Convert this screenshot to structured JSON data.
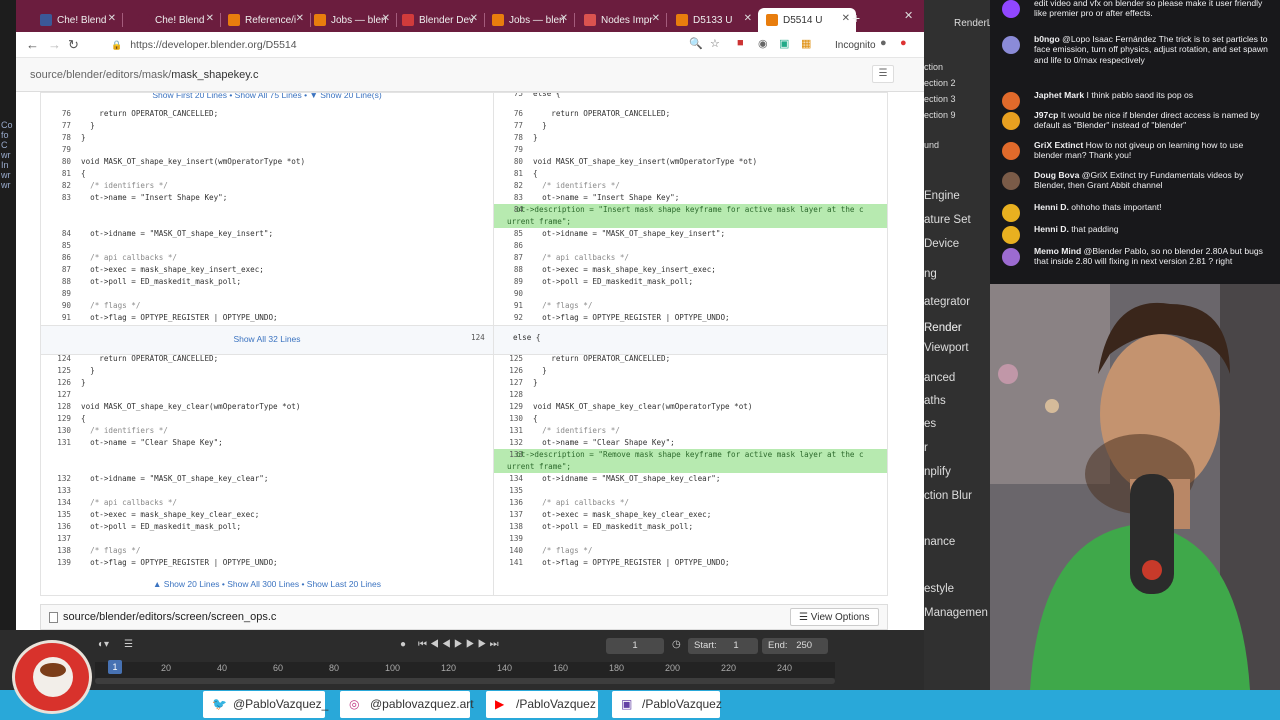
{
  "left_strip": {
    "lines": [
      "Co",
      "fo",
      "C",
      "",
      "",
      "",
      "",
      "",
      "",
      "",
      "",
      "",
      "",
      "wr",
      "In",
      "wr",
      "wr"
    ]
  },
  "browser": {
    "tabs": [
      {
        "label": "Che! Blend",
        "color": "#3b5998"
      },
      {
        "label": "Che! Blend",
        "color": "#6b1d3e"
      },
      {
        "label": "Reference/i",
        "color": "#e87d0d"
      },
      {
        "label": "Jobs — blen",
        "color": "#e87d0d"
      },
      {
        "label": "Blender Dev",
        "color": "#d13b3b"
      },
      {
        "label": "Jobs — blen",
        "color": "#e87d0d"
      },
      {
        "label": "Nodes Impr",
        "color": "#d9534f"
      },
      {
        "label": "D5133 U",
        "color": "#e87d0d"
      },
      {
        "label": "D5514 U",
        "color": "#e87d0d"
      }
    ],
    "new_tab": "+",
    "url": "https://developer.blender.org/D5514",
    "incognito": "Incognito",
    "breadcrumb_path": "source/blender/editors/mask/",
    "breadcrumb_file": "mask_shapekey.c",
    "context_top": "Show First 20 Lines • Show All 75 Lines • ▼ Show 20 Line(s)",
    "context_top_r_ln": "75",
    "context_top_r_code": "else {",
    "left_rows_1": [
      {
        "ln": "76",
        "code": "    return OPERATOR_CANCELLED;"
      },
      {
        "ln": "77",
        "code": "  }"
      },
      {
        "ln": "78",
        "code": "}"
      },
      {
        "ln": "79",
        "code": ""
      },
      {
        "ln": "80",
        "code": "void MASK_OT_shape_key_insert(wmOperatorType *ot)"
      },
      {
        "ln": "81",
        "code": "{"
      },
      {
        "ln": "82",
        "code": "  /* identifiers */"
      },
      {
        "ln": "83",
        "code": "  ot->name = \"Insert Shape Key\";"
      },
      {
        "ln": "",
        "code": ""
      },
      {
        "ln": "",
        "code": ""
      },
      {
        "ln": "84",
        "code": "  ot->idname = \"MASK_OT_shape_key_insert\";"
      },
      {
        "ln": "85",
        "code": ""
      },
      {
        "ln": "86",
        "code": "  /* api callbacks */"
      },
      {
        "ln": "87",
        "code": "  ot->exec = mask_shape_key_insert_exec;"
      },
      {
        "ln": "88",
        "code": "  ot->poll = ED_maskedit_mask_poll;"
      },
      {
        "ln": "89",
        "code": ""
      },
      {
        "ln": "90",
        "code": "  /* flags */"
      },
      {
        "ln": "91",
        "code": "  ot->flag = OPTYPE_REGISTER | OPTYPE_UNDO;"
      }
    ],
    "right_rows_1": [
      {
        "ln": "76",
        "code": "    return OPERATOR_CANCELLED;"
      },
      {
        "ln": "77",
        "code": "  }"
      },
      {
        "ln": "78",
        "code": "}"
      },
      {
        "ln": "79",
        "code": ""
      },
      {
        "ln": "80",
        "code": "void MASK_OT_shape_key_insert(wmOperatorType *ot)"
      },
      {
        "ln": "81",
        "code": "{"
      },
      {
        "ln": "82",
        "code": "  /* identifiers */"
      },
      {
        "ln": "83",
        "code": "  ot->name = \"Insert Shape Key\";"
      },
      {
        "ln": "84",
        "code": "  ot->description = \"Insert mask shape keyframe for active mask layer at the c",
        "add": true
      },
      {
        "ln": "",
        "code": "urrent frame\";",
        "add": true
      },
      {
        "ln": "85",
        "code": "  ot->idname = \"MASK_OT_shape_key_insert\";"
      },
      {
        "ln": "86",
        "code": ""
      },
      {
        "ln": "87",
        "code": "  /* api callbacks */"
      },
      {
        "ln": "88",
        "code": "  ot->exec = mask_shape_key_insert_exec;"
      },
      {
        "ln": "89",
        "code": "  ot->poll = ED_maskedit_mask_poll;"
      },
      {
        "ln": "90",
        "code": ""
      },
      {
        "ln": "91",
        "code": "  /* flags */"
      },
      {
        "ln": "92",
        "code": "  ot->flag = OPTYPE_REGISTER | OPTYPE_UNDO;"
      }
    ],
    "show_all_32": "Show All 32 Lines",
    "sep_r_ln": "124",
    "sep_r_code": "else {",
    "left_rows_2": [
      {
        "ln": "124",
        "code": "    return OPERATOR_CANCELLED;"
      },
      {
        "ln": "125",
        "code": "  }"
      },
      {
        "ln": "126",
        "code": "}"
      },
      {
        "ln": "127",
        "code": ""
      },
      {
        "ln": "128",
        "code": "void MASK_OT_shape_key_clear(wmOperatorType *ot)"
      },
      {
        "ln": "129",
        "code": "{"
      },
      {
        "ln": "130",
        "code": "  /* identifiers */"
      },
      {
        "ln": "131",
        "code": "  ot->name = \"Clear Shape Key\";"
      },
      {
        "ln": "",
        "code": ""
      },
      {
        "ln": "",
        "code": ""
      },
      {
        "ln": "132",
        "code": "  ot->idname = \"MASK_OT_shape_key_clear\";"
      },
      {
        "ln": "133",
        "code": ""
      },
      {
        "ln": "134",
        "code": "  /* api callbacks */"
      },
      {
        "ln": "135",
        "code": "  ot->exec = mask_shape_key_clear_exec;"
      },
      {
        "ln": "136",
        "code": "  ot->poll = ED_maskedit_mask_poll;"
      },
      {
        "ln": "137",
        "code": ""
      },
      {
        "ln": "138",
        "code": "  /* flags */"
      },
      {
        "ln": "139",
        "code": "  ot->flag = OPTYPE_REGISTER | OPTYPE_UNDO;"
      }
    ],
    "right_rows_2": [
      {
        "ln": "125",
        "code": "    return OPERATOR_CANCELLED;"
      },
      {
        "ln": "126",
        "code": "  }"
      },
      {
        "ln": "127",
        "code": "}"
      },
      {
        "ln": "128",
        "code": ""
      },
      {
        "ln": "129",
        "code": "void MASK_OT_shape_key_clear(wmOperatorType *ot)"
      },
      {
        "ln": "130",
        "code": "{"
      },
      {
        "ln": "131",
        "code": "  /* identifiers */"
      },
      {
        "ln": "132",
        "code": "  ot->name = \"Clear Shape Key\";"
      },
      {
        "ln": "133",
        "code": "  ot->description = \"Remove mask shape keyframe for active mask layer at the c",
        "add": true
      },
      {
        "ln": "",
        "code": "urrent frame\";",
        "add": true
      },
      {
        "ln": "134",
        "code": "  ot->idname = \"MASK_OT_shape_key_clear\";"
      },
      {
        "ln": "135",
        "code": ""
      },
      {
        "ln": "136",
        "code": "  /* api callbacks */"
      },
      {
        "ln": "137",
        "code": "  ot->exec = mask_shape_key_clear_exec;"
      },
      {
        "ln": "138",
        "code": "  ot->poll = ED_maskedit_mask_poll;"
      },
      {
        "ln": "139",
        "code": ""
      },
      {
        "ln": "140",
        "code": "  /* flags */"
      },
      {
        "ln": "141",
        "code": "  ot->flag = OPTYPE_REGISTER | OPTYPE_UNDO;"
      }
    ],
    "context_bottom": "▲ Show 20 Lines • Show All 300 Lines • Show Last 20 Lines",
    "file2": "source/blender/editors/screen/screen_ops.c",
    "view_options": "View Options"
  },
  "timeline": {
    "current_frame": "1",
    "frame_field": "1",
    "start_label": "Start:",
    "start_value": "1",
    "end_label": "End:",
    "end_value": "250",
    "ticks": [
      "20",
      "40",
      "60",
      "80",
      "100",
      "120",
      "140",
      "160",
      "180",
      "200",
      "220",
      "240"
    ]
  },
  "blender_side": [
    "ction",
    "ection 2",
    "ection 3",
    "ection 9",
    "und",
    "Render",
    "Engine",
    "ature Set",
    "Device",
    "ng",
    "ategrator",
    "Render",
    "Viewport",
    "anced",
    "aths",
    "es",
    "r",
    "nplify",
    "ction Blur",
    "nance",
    "estyle",
    "Managemen"
  ],
  "blender_side_top": "RenderL",
  "chat": [
    {
      "user": "",
      "text": "edit video and vfx on blender so please make it user friendly like premier pro or after effects.",
      "color": "#ffffff",
      "av": "#9147ff"
    },
    {
      "user": "b0ngo",
      "text": "@Lopo Isaac Fernández The trick is to set particles to face emission, turn off physics, adjust rotation, and set spawn and life to 0/max respectively",
      "color": "#ffffff",
      "av": "#8b8bd8"
    },
    {
      "user": "Japhet Mark",
      "text": "I think pablo saod its pop os",
      "color": "#ffffff",
      "av": "#e06a2b"
    },
    {
      "user": "J97cp",
      "text": "It would be nice if blender direct access is named by default as \"Blender\" instead of \"blender\"",
      "color": "#ffffff",
      "av": "#e8a020"
    },
    {
      "user": "GriX Extinct",
      "text": "How to not giveup on learning how to use blender man? Thank you!",
      "color": "#ffffff",
      "av": "#e06a2b"
    },
    {
      "user": "Doug Bova",
      "text": "@GriX Extinct try Fundamentals videos by Blender, then Grant Abbit channel",
      "color": "#ffffff",
      "av": "#7a5b48"
    },
    {
      "user": "Henni D.",
      "text": "ohhoho thats important!",
      "color": "#ffffff",
      "av": "#e8b020"
    },
    {
      "user": "Henni D.",
      "text": "that padding",
      "color": "#ffffff",
      "av": "#e8b020"
    },
    {
      "user": "Memo Mind",
      "text": "@Blender Pablo, so no blender 2.80A but bugs that inside 2.80 will fixing in next version 2.81 ? right",
      "color": "#ffffff",
      "av": "#9c6bd1"
    }
  ],
  "social": [
    {
      "icon": "twitter-icon",
      "glyph": "🐦",
      "label": "@PabloVazquez_",
      "color": "#1da1f2"
    },
    {
      "icon": "instagram-icon",
      "glyph": "◎",
      "label": "@pablovazquez.art",
      "color": "#c13584"
    },
    {
      "icon": "youtube-icon",
      "glyph": "▶",
      "label": "/PabloVazquez",
      "color": "#ff0000"
    },
    {
      "icon": "twitch-icon",
      "glyph": "▣",
      "label": "/PabloVazquez",
      "color": "#6441a5"
    }
  ]
}
